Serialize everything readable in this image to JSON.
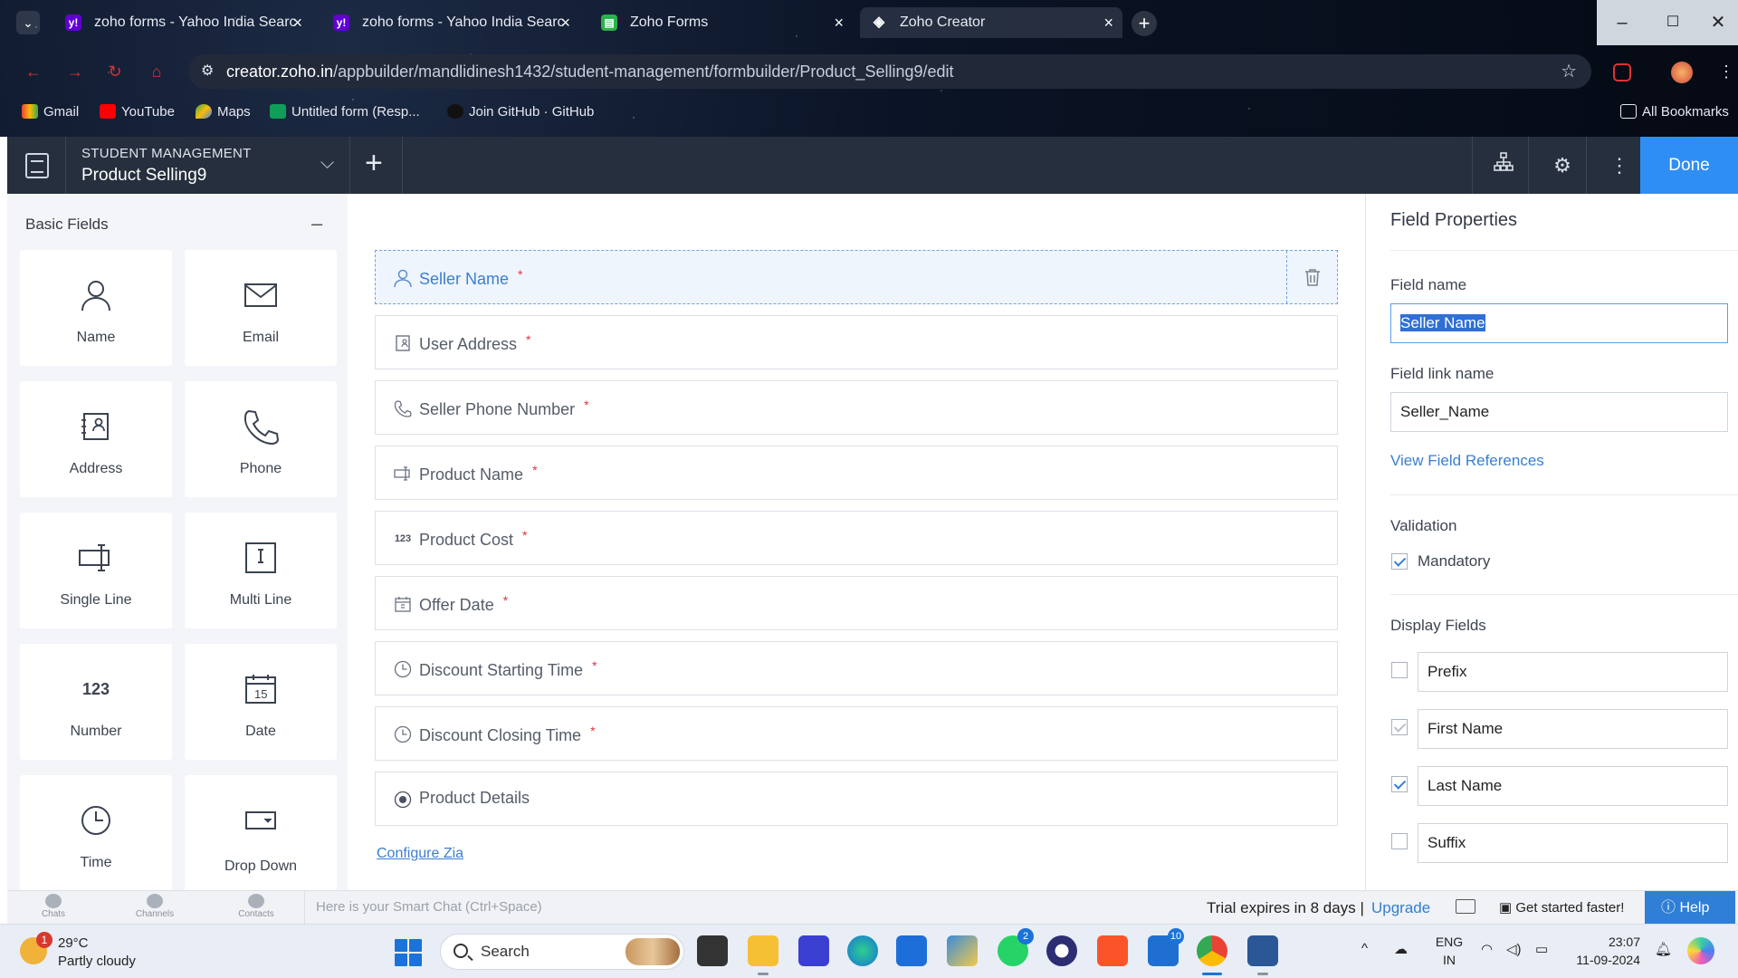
{
  "browser": {
    "tabs": [
      {
        "title": "zoho forms - Yahoo India Searc",
        "icon": "yahoo-icon",
        "color": "#6001d2"
      },
      {
        "title": "zoho forms - Yahoo India Searc",
        "icon": "yahoo-icon",
        "color": "#6001d2"
      },
      {
        "title": "Zoho Forms",
        "icon": "zoho-forms-icon",
        "color": "#2ab24b"
      },
      {
        "title": "Zoho Creator",
        "icon": "zoho-creator-icon",
        "color": "#ffffff"
      }
    ],
    "url_host": "creator.zoho.in",
    "url_path": "/appbuilder/mandlidinesh1432/student-management/formbuilder/Product_Selling9/edit",
    "bookmarks": [
      "Gmail",
      "YouTube",
      "Maps",
      "Untitled form (Resp...",
      "Join GitHub · GitHub"
    ],
    "all_bookmarks": "All Bookmarks"
  },
  "header": {
    "app_name": "STUDENT MANAGEMENT",
    "form_name": "Product Selling9",
    "done_label": "Done"
  },
  "palette": {
    "title": "Basic Fields",
    "tiles": [
      "Name",
      "Email",
      "Address",
      "Phone",
      "Single Line",
      "Multi Line",
      "Number",
      "Date",
      "Time",
      "Drop Down"
    ],
    "number_glyph": "123",
    "date_glyph": "15"
  },
  "form": {
    "fields": [
      {
        "label": "Seller Name",
        "required": "*",
        "icon": "person-icon"
      },
      {
        "label": "User Address",
        "required": "*",
        "icon": "address-icon"
      },
      {
        "label": "Seller Phone Number",
        "required": "*",
        "icon": "phone-icon"
      },
      {
        "label": "Product Name",
        "required": "*",
        "icon": "single-line-icon"
      },
      {
        "label": "Product Cost",
        "required": "*",
        "icon": "number-icon"
      },
      {
        "label": "Offer Date",
        "required": "*",
        "icon": "date-icon"
      },
      {
        "label": "Discount Starting Time",
        "required": "*",
        "icon": "clock-icon"
      },
      {
        "label": "Discount Closing Time",
        "required": "*",
        "icon": "clock-icon"
      },
      {
        "label": "Product Details",
        "required": "",
        "icon": "radio-icon"
      }
    ],
    "number_glyph": "123",
    "configure_zia": "Configure Zia"
  },
  "properties": {
    "title": "Field Properties",
    "field_name_label": "Field name",
    "field_name_value": "Seller Name",
    "field_link_label": "Field link name",
    "field_link_value": "Seller_Name",
    "view_refs": "View Field References",
    "validation_label": "Validation",
    "mandatory_label": "Mandatory",
    "display_fields_label": "Display Fields",
    "display_fields": [
      {
        "label": "Prefix",
        "checked": false
      },
      {
        "label": "First Name",
        "checked": true
      },
      {
        "label": "Last Name",
        "checked": true
      },
      {
        "label": "Suffix",
        "checked": false
      }
    ]
  },
  "zoho_bar": {
    "chats": "Chats",
    "channels": "Channels",
    "contacts": "Contacts",
    "chat_placeholder": "Here is your Smart Chat (Ctrl+Space)",
    "trial": "Trial expires in 8 days",
    "pipe": "|",
    "upgrade": "Upgrade",
    "get_started": "Get started faster!",
    "help": "Help"
  },
  "taskbar": {
    "weather_temp": "29°C",
    "weather_cond": "Partly cloudy",
    "weather_badge": "1",
    "search": "Search",
    "whatsapp_badge": "2",
    "todo_badge": "10",
    "lang_top": "ENG",
    "lang_bottom": "IN",
    "time": "23:07",
    "date": "11-09-2024"
  },
  "colors": {
    "accent": "#2f8ef3",
    "header_bg": "#262f3d",
    "required": "#e0323c"
  }
}
